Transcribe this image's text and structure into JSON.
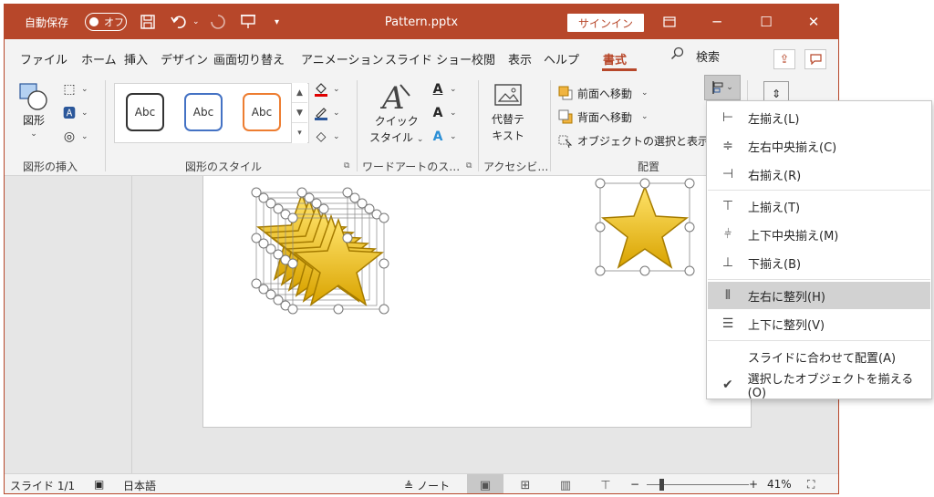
{
  "titlebar": {
    "autosave_label": "自動保存",
    "autosave_state": "オフ",
    "file_name": "Pattern.pptx",
    "signin": "サインイン"
  },
  "tabs": [
    "ファイル",
    "ホーム",
    "挿入",
    "デザイン",
    "画面切り替え",
    "アニメーション",
    "スライド ショー",
    "校閲",
    "表示",
    "ヘルプ",
    "書式"
  ],
  "search_label": "検索",
  "ribbon": {
    "shape_btn": "図形",
    "group_insert": "図形の挿入",
    "gallery_item": "Abc",
    "group_styles": "図形のスタイル",
    "quickstyle_line1": "クイック",
    "quickstyle_line2": "スタイル",
    "group_wordart": "ワードアートのス…",
    "alt_text_line1": "代替テ",
    "alt_text_line2": "キスト",
    "group_access": "アクセシビ…",
    "bring_forward": "前面へ移動",
    "send_backward": "背面へ移動",
    "selection_pane": "オブジェクトの選択と表示",
    "group_arrange": "配置"
  },
  "align_menu": {
    "items": [
      {
        "label": "左揃え(L)"
      },
      {
        "label": "左右中央揃え(C)"
      },
      {
        "label": "右揃え(R)"
      },
      {
        "label": "上揃え(T)"
      },
      {
        "label": "上下中央揃え(M)"
      },
      {
        "label": "下揃え(B)"
      },
      {
        "label": "左右に整列(H)"
      },
      {
        "label": "上下に整列(V)"
      },
      {
        "label": "スライドに合わせて配置(A)"
      },
      {
        "label": "選択したオブジェクトを揃える(O)"
      }
    ]
  },
  "status": {
    "slide": "スライド 1/1",
    "language": "日本語",
    "notes": "ノート",
    "zoom": "41%"
  },
  "colors": {
    "accent": "#b7472a",
    "star": "#f2c200"
  }
}
